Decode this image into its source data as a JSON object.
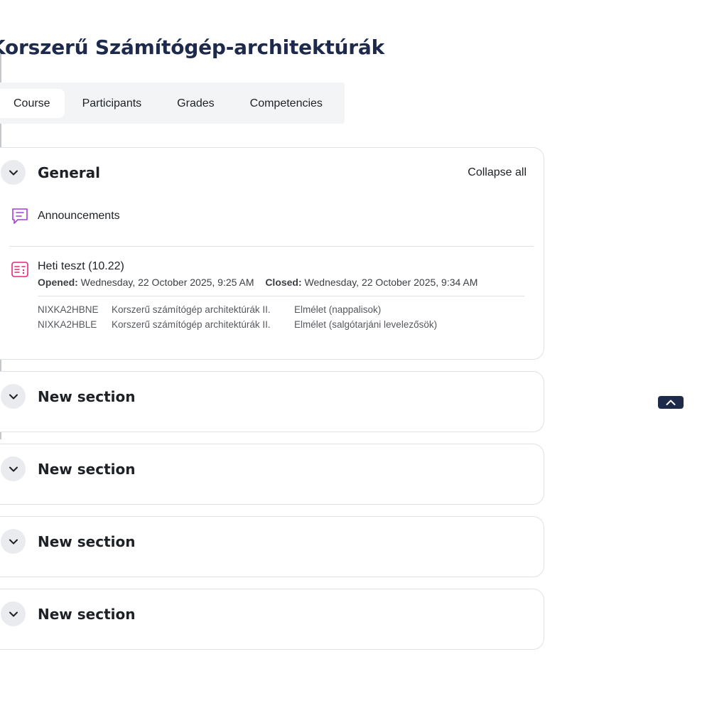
{
  "page_title": "Korszerű Számítógép-architektúrák",
  "tabs": [
    {
      "label": "Course",
      "active": true
    },
    {
      "label": "Participants",
      "active": false
    },
    {
      "label": "Grades",
      "active": false
    },
    {
      "label": "Competencies",
      "active": false
    }
  ],
  "general": {
    "title": "General",
    "collapse_all": "Collapse all",
    "announcements": {
      "name": "Announcements",
      "icon": "forum-icon"
    },
    "quiz": {
      "name": "Heti teszt (10.22)",
      "icon": "quiz-icon",
      "opened_label": "Opened:",
      "opened_value": "Wednesday, 22 October 2025, 9:25 AM",
      "closed_label": "Closed:",
      "closed_value": "Wednesday, 22 October 2025, 9:34 AM",
      "restrictions": [
        {
          "code": "NIXKA2HBNE",
          "course": "Korszerű számítógép architektúrák II.",
          "group": "Elmélet (nappalisok)"
        },
        {
          "code": "NIXKA2HBLE",
          "course": "Korszerű számítógép architektúrák II.",
          "group": "Elmélet (salgótarjáni levelezősök)"
        }
      ]
    }
  },
  "sections": [
    {
      "title": "New section"
    },
    {
      "title": "New section"
    },
    {
      "title": "New section"
    },
    {
      "title": "New section"
    }
  ],
  "colors": {
    "title": "#1d2a4b",
    "forum_icon": "#a33fd6",
    "quiz_icon": "#e4277a",
    "back_to_top": "#1d2a4b"
  }
}
